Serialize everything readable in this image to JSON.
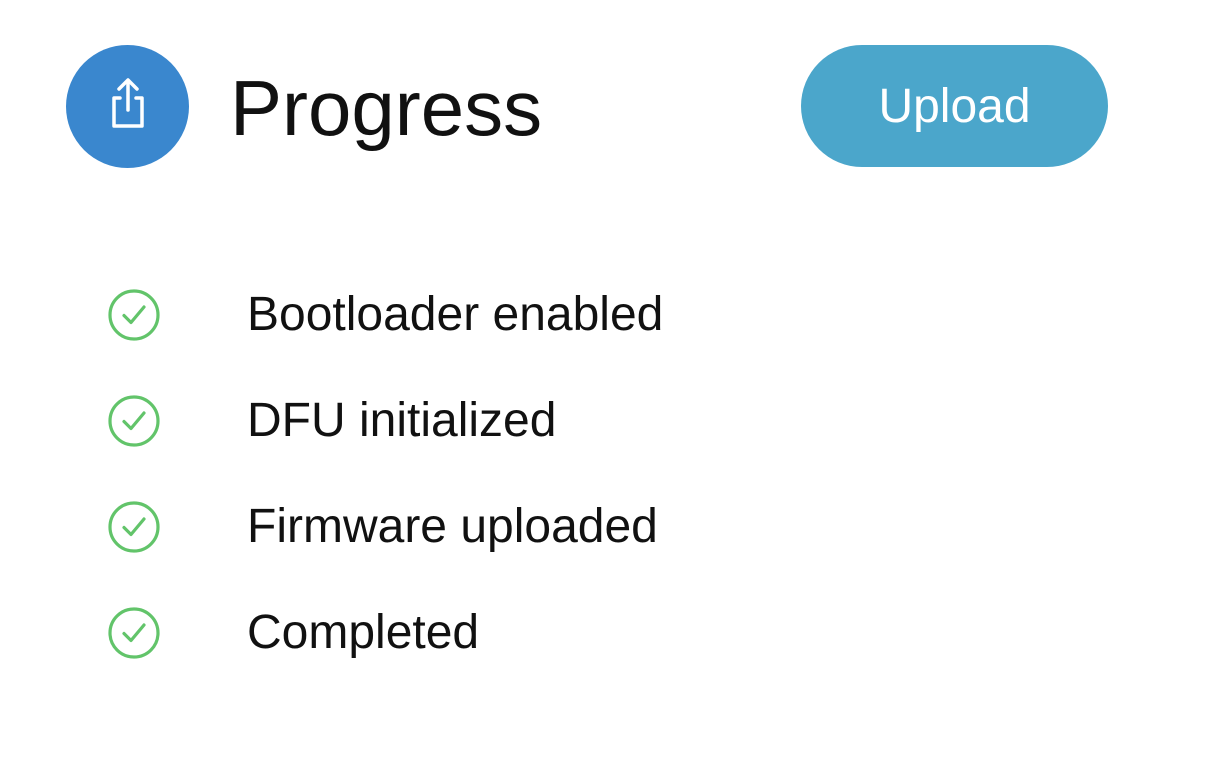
{
  "header": {
    "icon": "share-upload-icon",
    "title": "Progress",
    "upload_label": "Upload"
  },
  "steps": [
    {
      "label": "Bootloader enabled",
      "status": "done",
      "icon": "checkmark-circle-icon"
    },
    {
      "label": "DFU initialized",
      "status": "done",
      "icon": "checkmark-circle-icon"
    },
    {
      "label": "Firmware uploaded",
      "status": "done",
      "icon": "checkmark-circle-icon"
    },
    {
      "label": "Completed",
      "status": "done",
      "icon": "checkmark-circle-icon"
    }
  ],
  "colors": {
    "icon_circle": "#3A87CE",
    "upload_button": "#4BA6CB",
    "check_green": "#62C46A",
    "text": "#111111"
  }
}
